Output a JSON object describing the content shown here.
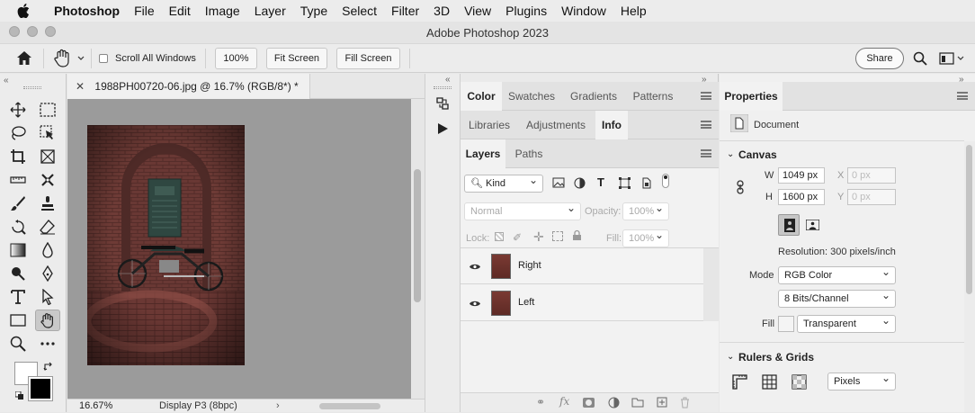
{
  "menubar": {
    "app_name": "Photoshop",
    "items": [
      "File",
      "Edit",
      "Image",
      "Layer",
      "Type",
      "Select",
      "Filter",
      "3D",
      "View",
      "Plugins",
      "Window",
      "Help"
    ]
  },
  "window": {
    "title": "Adobe Photoshop 2023"
  },
  "options": {
    "scroll_all_label": "Scroll All Windows",
    "zoom_value": "100%",
    "fit_screen": "Fit Screen",
    "fill_screen": "Fill Screen",
    "share": "Share"
  },
  "document": {
    "tab_title": "1988PH00720-06.jpg @ 16.7% (RGB/8*) *",
    "zoom_status": "16.67%",
    "color_profile": "Display P3 (8bpc)"
  },
  "panels": {
    "row1_tabs": [
      "Color",
      "Swatches",
      "Gradients",
      "Patterns"
    ],
    "row2_tabs": [
      "Libraries",
      "Adjustments",
      "Info"
    ],
    "layers_tabs": [
      "Layers",
      "Paths"
    ],
    "filter_kind": "Kind",
    "blend_mode": "Normal",
    "opacity_label": "Opacity:",
    "opacity_value": "100%",
    "lock_label": "Lock:",
    "fill_label": "Fill:",
    "fill_value": "100%",
    "layers": [
      {
        "name": "Right"
      },
      {
        "name": "Left"
      }
    ]
  },
  "properties": {
    "title": "Properties",
    "doc_label": "Document",
    "canvas_section": "Canvas",
    "w_label": "W",
    "w_value": "1049 px",
    "h_label": "H",
    "h_value": "1600 px",
    "x_label": "X",
    "x_placeholder": "0 px",
    "y_label": "Y",
    "y_placeholder": "0 px",
    "resolution": "Resolution: 300 pixels/inch",
    "mode_label": "Mode",
    "mode_value": "RGB Color",
    "bits_value": "8 Bits/Channel",
    "fill_label": "Fill",
    "fill_value": "Transparent",
    "rulers_section": "Rulers & Grids",
    "units_value": "Pixels"
  },
  "colors": {
    "accent": "#1473e6",
    "panel_bg": "#f0f0f0"
  }
}
